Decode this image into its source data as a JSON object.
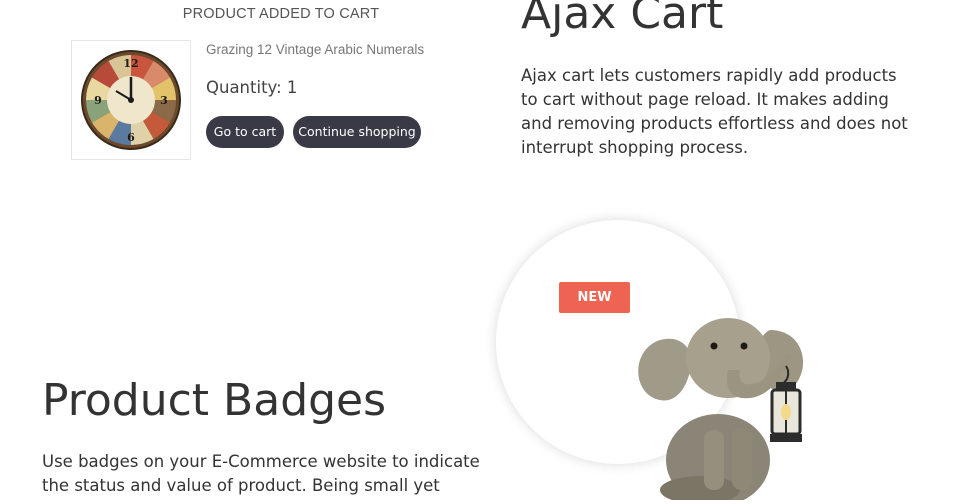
{
  "cart_popup": {
    "heading": "PRODUCT ADDED TO CART",
    "product_name": "Grazing 12 Vintage Arabic Numerals",
    "quantity": "Quantity: 1",
    "go_to_cart": "Go to cart",
    "continue_shopping": "Continue shopping"
  },
  "ajax_cart": {
    "title": "Ajax Cart",
    "description": "Ajax cart lets customers rapidly add products to cart without page reload. It makes adding and removing products effortless and does not interrupt shopping process."
  },
  "product_badges": {
    "badge_label": "NEW",
    "title": "Product Badges",
    "description": "Use badges on your E-Commerce website to indicate the status and value of product. Being small yet"
  },
  "colors": {
    "button_bg": "#3a3a46",
    "badge_bg": "#ee6352"
  }
}
